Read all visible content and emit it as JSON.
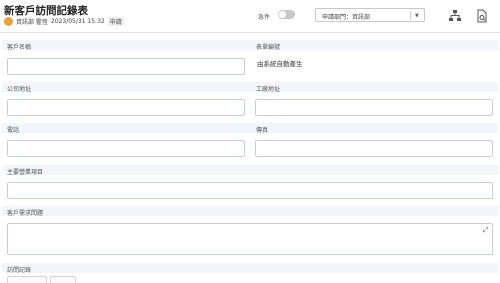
{
  "header": {
    "title": "新客戶訪問記錄表",
    "dept_user": "資訊部 霍恆",
    "datetime": "2023/05/31 15:32",
    "status": "申請"
  },
  "toolbar": {
    "urgent_label": "急件",
    "dept_select_value": "申請部門：資訊部",
    "org_icon": "org-chart-icon",
    "doc_icon": "document-search-icon"
  },
  "form": {
    "customer_name_label": "客戶名稱",
    "form_no_label": "表單編號",
    "form_no_value": "由系統自動產生",
    "company_address_label": "公司地址",
    "factory_address_label": "工廠地址",
    "phone_label": "電話",
    "fax_label": "傳真",
    "main_business_label": "主要營業項目",
    "customer_needs_label": "客戶需求問題",
    "visit_record_label": "訪問記錄"
  }
}
